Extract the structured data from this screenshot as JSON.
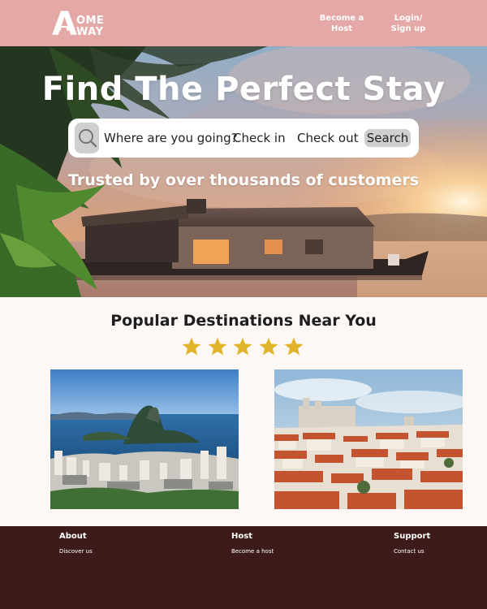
{
  "nav": {
    "logo_big": "A",
    "logo_line1": "OME",
    "logo_line2": "WAY",
    "become_host": "Become a\nHost",
    "login": "Login/\nSign up"
  },
  "hero": {
    "title": "Find The Perfect Stay",
    "subtitle": "Trusted by over thousands of customers",
    "search": {
      "where_placeholder": "Where are you going?",
      "check_in": "Check in",
      "check_out": "Check out",
      "button": "Search"
    }
  },
  "popular": {
    "title": "Popular Destinations Near You",
    "rating": 5,
    "star_color": "#e2b42a"
  },
  "footer": {
    "columns": [
      {
        "heading": "About",
        "link": "Discover us"
      },
      {
        "heading": "Host",
        "link": "Become a host"
      },
      {
        "heading": "Support",
        "link": "Contact us"
      }
    ]
  },
  "colors": {
    "nav_bg": "#e4a9a7",
    "footer_bg": "#3d1b1b",
    "page_bg": "#fdf8f6"
  },
  "icons": {
    "search": "search-icon",
    "star": "star-icon"
  }
}
